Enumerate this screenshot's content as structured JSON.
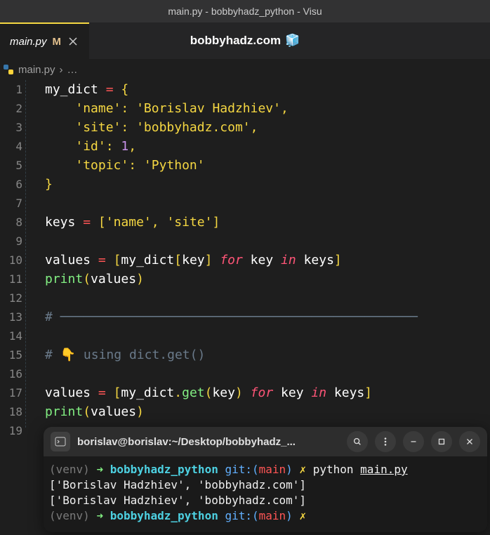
{
  "window": {
    "title": "main.py - bobbyhadz_python - Visu"
  },
  "tab": {
    "filename": "main.py",
    "modified": "M",
    "watermark": "bobbyhadz.com"
  },
  "breadcrumb": {
    "file": "main.py",
    "sep": "›",
    "rest": "…"
  },
  "chart_data": {
    "type": "table",
    "language": "python",
    "lines": [
      {
        "n": 1,
        "tokens": [
          [
            "var",
            "my_dict"
          ],
          [
            "sp",
            " "
          ],
          [
            "op",
            "="
          ],
          [
            "sp",
            " "
          ],
          [
            "punc",
            "{"
          ]
        ]
      },
      {
        "n": 2,
        "tokens": [
          [
            "sp",
            "    "
          ],
          [
            "str",
            "'name'"
          ],
          [
            "punc",
            ":"
          ],
          [
            "sp",
            " "
          ],
          [
            "str",
            "'Borislav Hadzhiev'"
          ],
          [
            "punc",
            ","
          ]
        ]
      },
      {
        "n": 3,
        "tokens": [
          [
            "sp",
            "    "
          ],
          [
            "str",
            "'site'"
          ],
          [
            "punc",
            ":"
          ],
          [
            "sp",
            " "
          ],
          [
            "str",
            "'bobbyhadz.com'"
          ],
          [
            "punc",
            ","
          ]
        ]
      },
      {
        "n": 4,
        "tokens": [
          [
            "sp",
            "    "
          ],
          [
            "str",
            "'id'"
          ],
          [
            "punc",
            ":"
          ],
          [
            "sp",
            " "
          ],
          [
            "num",
            "1"
          ],
          [
            "punc",
            ","
          ]
        ]
      },
      {
        "n": 5,
        "tokens": [
          [
            "sp",
            "    "
          ],
          [
            "str",
            "'topic'"
          ],
          [
            "punc",
            ":"
          ],
          [
            "sp",
            " "
          ],
          [
            "str",
            "'Python'"
          ]
        ]
      },
      {
        "n": 6,
        "tokens": [
          [
            "punc",
            "}"
          ]
        ]
      },
      {
        "n": 7,
        "tokens": []
      },
      {
        "n": 8,
        "tokens": [
          [
            "var",
            "keys"
          ],
          [
            "sp",
            " "
          ],
          [
            "op",
            "="
          ],
          [
            "sp",
            " "
          ],
          [
            "punc",
            "["
          ],
          [
            "str",
            "'name'"
          ],
          [
            "punc",
            ","
          ],
          [
            "sp",
            " "
          ],
          [
            "str",
            "'site'"
          ],
          [
            "punc",
            "]"
          ]
        ]
      },
      {
        "n": 9,
        "tokens": []
      },
      {
        "n": 10,
        "tokens": [
          [
            "var",
            "values"
          ],
          [
            "sp",
            " "
          ],
          [
            "op",
            "="
          ],
          [
            "sp",
            " "
          ],
          [
            "punc",
            "["
          ],
          [
            "var",
            "my_dict"
          ],
          [
            "punc",
            "["
          ],
          [
            "var",
            "key"
          ],
          [
            "punc",
            "]"
          ],
          [
            "sp",
            " "
          ],
          [
            "kw",
            "for"
          ],
          [
            "sp",
            " "
          ],
          [
            "var",
            "key"
          ],
          [
            "sp",
            " "
          ],
          [
            "kw",
            "in"
          ],
          [
            "sp",
            " "
          ],
          [
            "var",
            "keys"
          ],
          [
            "punc",
            "]"
          ]
        ]
      },
      {
        "n": 11,
        "tokens": [
          [
            "fn",
            "print"
          ],
          [
            "punc",
            "("
          ],
          [
            "var",
            "values"
          ],
          [
            "punc",
            ")"
          ]
        ]
      },
      {
        "n": 12,
        "tokens": []
      },
      {
        "n": 13,
        "tokens": [
          [
            "cmt",
            "# ───────────────────────────────────────────────"
          ]
        ]
      },
      {
        "n": 14,
        "tokens": []
      },
      {
        "n": 15,
        "tokens": [
          [
            "cmt",
            "# 👇 using dict.get()"
          ]
        ]
      },
      {
        "n": 16,
        "tokens": []
      },
      {
        "n": 17,
        "tokens": [
          [
            "var",
            "values"
          ],
          [
            "sp",
            " "
          ],
          [
            "op",
            "="
          ],
          [
            "sp",
            " "
          ],
          [
            "punc",
            "["
          ],
          [
            "var",
            "my_dict"
          ],
          [
            "punc",
            "."
          ],
          [
            "fn",
            "get"
          ],
          [
            "punc",
            "("
          ],
          [
            "var",
            "key"
          ],
          [
            "punc",
            ")"
          ],
          [
            "sp",
            " "
          ],
          [
            "kw",
            "for"
          ],
          [
            "sp",
            " "
          ],
          [
            "var",
            "key"
          ],
          [
            "sp",
            " "
          ],
          [
            "kw",
            "in"
          ],
          [
            "sp",
            " "
          ],
          [
            "var",
            "keys"
          ],
          [
            "punc",
            "]"
          ]
        ]
      },
      {
        "n": 18,
        "tokens": [
          [
            "fn",
            "print"
          ],
          [
            "punc",
            "("
          ],
          [
            "var",
            "values"
          ],
          [
            "punc",
            ")"
          ]
        ]
      },
      {
        "n": 19,
        "tokens": []
      }
    ]
  },
  "terminal": {
    "title": "borislav@borislav:~/Desktop/bobbyhadz_...",
    "lines": [
      [
        [
          "dim",
          "(venv) "
        ],
        [
          "arrow",
          "➜  "
        ],
        [
          "cyan",
          "bobbyhadz_python"
        ],
        [
          "sp",
          " "
        ],
        [
          "blue",
          "git:("
        ],
        [
          "red",
          "main"
        ],
        [
          "blue",
          ")"
        ],
        [
          "sp",
          " "
        ],
        [
          "yel",
          "✗"
        ],
        [
          "sp",
          " "
        ],
        [
          "white",
          "python "
        ],
        [
          "under",
          "main.py"
        ]
      ],
      [
        [
          "white",
          "['Borislav Hadzhiev', 'bobbyhadz.com']"
        ]
      ],
      [
        [
          "white",
          "['Borislav Hadzhiev', 'bobbyhadz.com']"
        ]
      ],
      [
        [
          "dim",
          "(venv) "
        ],
        [
          "arrow",
          "➜  "
        ],
        [
          "cyan",
          "bobbyhadz_python"
        ],
        [
          "sp",
          " "
        ],
        [
          "blue",
          "git:("
        ],
        [
          "red",
          "main"
        ],
        [
          "blue",
          ")"
        ],
        [
          "sp",
          " "
        ],
        [
          "yel",
          "✗"
        ]
      ]
    ]
  }
}
